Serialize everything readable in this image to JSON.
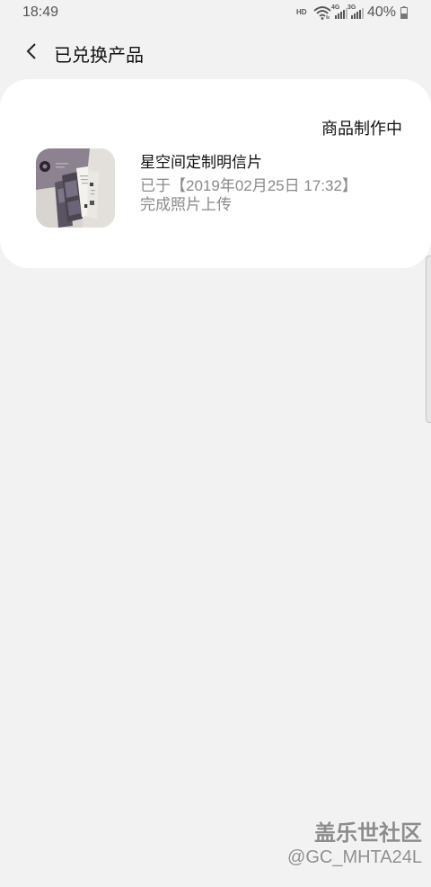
{
  "status_bar": {
    "time": "18:49",
    "hd_label": "HD",
    "wifi_icon": "wifi-icon",
    "network1_label": "4G",
    "network2_label": "3G",
    "signal_icon": "signal-bars-icon",
    "battery_text": "40%",
    "battery_icon": "battery-icon"
  },
  "header": {
    "back_icon": "chevron-left-icon",
    "title": "已兑换产品"
  },
  "products": [
    {
      "status": "商品制作中",
      "name": "星空间定制明信片",
      "note_line1": "已于【2019年02月25日 17:32】",
      "note_line2": "完成照片上传",
      "thumbnail": "postcard-set-photo"
    }
  ],
  "watermark": {
    "brand": "盖乐世社区",
    "user": "@GC_MHTA24L"
  },
  "colors": {
    "background": "#f2f2f2",
    "card": "#ffffff",
    "text_primary": "#111111",
    "text_secondary": "#8a8a8a"
  }
}
